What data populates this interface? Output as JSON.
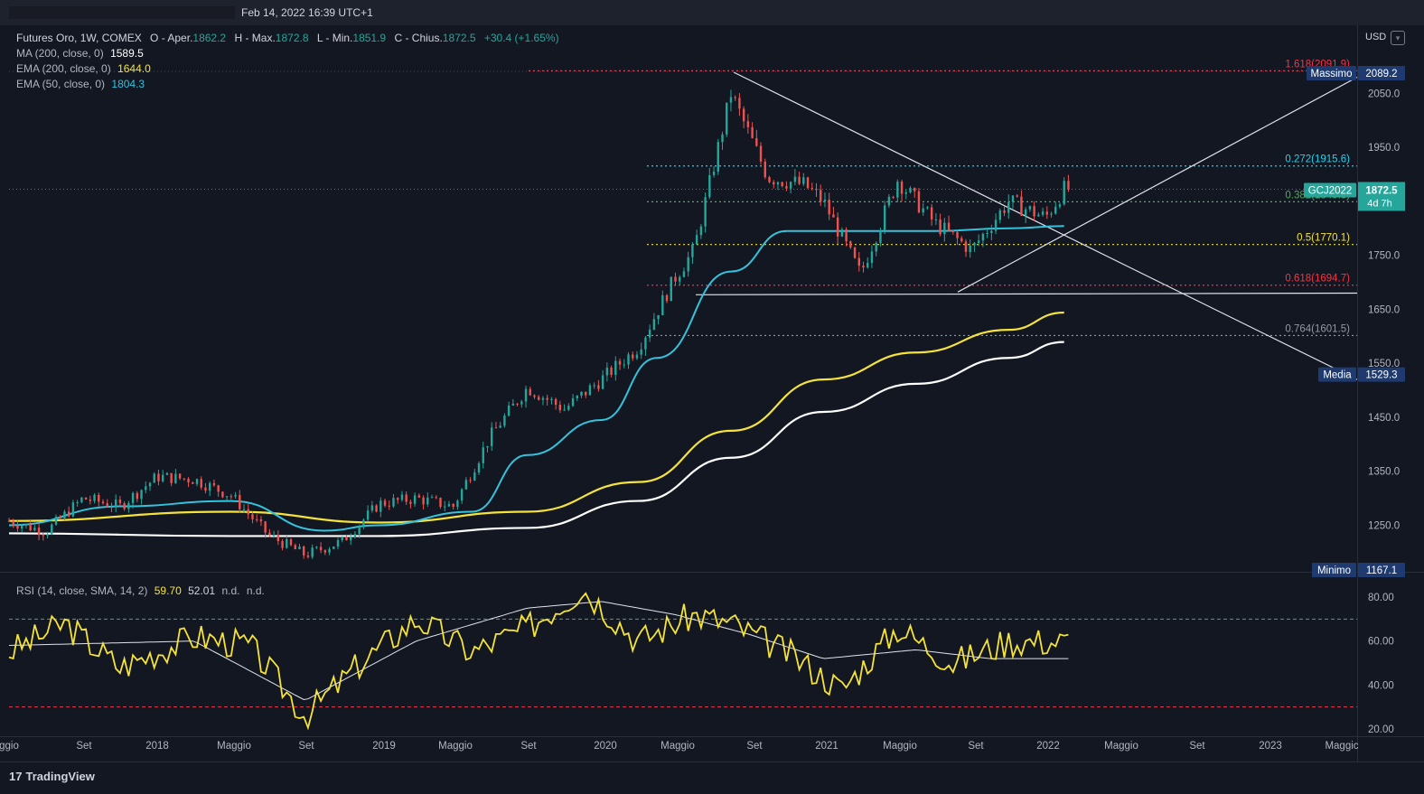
{
  "header": {
    "timestamp": "Feb 14, 2022 16:39 UTC+1"
  },
  "legend": {
    "main_title": "Futures Oro, 1W, COMEX",
    "open_label": "O - Aper.",
    "open": "1862.2",
    "high_label": "H - Max.",
    "high": "1872.8",
    "low_label": "L - Min.",
    "low": "1851.9",
    "close_label": "C - Chius.",
    "close": "1872.5",
    "change": "+30.4 (+1.65%)",
    "ma200": {
      "label": "MA (200, close, 0)",
      "value": "1589.5",
      "color": "#ffffff"
    },
    "ema200": {
      "label": "EMA (200, close, 0)",
      "value": "1644.0",
      "color": "#f5e33a"
    },
    "ema50": {
      "label": "EMA (50, close, 0)",
      "value": "1804.3",
      "color": "#33c3dd"
    }
  },
  "rsi_legend": {
    "label": "RSI (14, close, SMA, 14, 2)",
    "rsi": "59.70",
    "sma": "52.01",
    "na1": "n.d.",
    "na2": "n.d."
  },
  "currency": "USD",
  "price_axis": {
    "ticks": [
      "2050.0",
      "1950.0",
      "1750.0",
      "1650.0",
      "1550.0",
      "1450.0",
      "1350.0",
      "1250.0"
    ]
  },
  "rsi_axis": {
    "ticks": [
      "80.00",
      "60.00",
      "40.00",
      "20.00"
    ]
  },
  "time_axis": [
    "ggio",
    "Set",
    "2018",
    "Maggio",
    "Set",
    "2019",
    "Maggio",
    "Set",
    "2020",
    "Maggio",
    "Set",
    "2021",
    "Maggio",
    "Set",
    "2022",
    "Maggio",
    "Set",
    "2023",
    "Maggic"
  ],
  "fib_levels": [
    {
      "label": "1.618(2091.9)",
      "value": 2091.9,
      "color": "#f23645"
    },
    {
      "label": "0.272(1915.6)",
      "value": 1915.6,
      "color": "#22d3ee"
    },
    {
      "label": "0.382(1849.3)",
      "value": 1849.3,
      "color": "#4caf50"
    },
    {
      "label": "0.5(1770.1)",
      "value": 1770.1,
      "color": "#f5e33a"
    },
    {
      "label": "0.618(1694.7)",
      "value": 1694.7,
      "color": "#f23645"
    },
    {
      "label": "0.764(1601.5)",
      "value": 1601.5,
      "color": "#9598a1"
    }
  ],
  "badges": {
    "high_label": "Massimo",
    "high_value": "2089.2",
    "mid_label": "Media",
    "mid_value": "1529.3",
    "low_label": "Minimo",
    "low_value": "1167.1",
    "symbol": "GCJ2022",
    "last": "1872.5",
    "countdown": "4d 7h"
  },
  "brand": "TradingView",
  "chart_data": {
    "type": "candlestick",
    "title": "Futures Oro, 1W, COMEX",
    "y_range": [
      1150,
      2120
    ],
    "rsi_range": [
      18,
      86
    ],
    "rsi_levels": [
      70,
      30
    ],
    "series": [
      {
        "name": "Futures Oro",
        "x": [
          "2017-05",
          "2017-07",
          "2017-09",
          "2017-11",
          "2018-01",
          "2018-03",
          "2018-05",
          "2018-07",
          "2018-09",
          "2018-11",
          "2019-01",
          "2019-03",
          "2019-05",
          "2019-07",
          "2019-09",
          "2019-11",
          "2020-01",
          "2020-03",
          "2020-05",
          "2020-06",
          "2020-08",
          "2020-10",
          "2020-12",
          "2021-01",
          "2021-03",
          "2021-05",
          "2021-07",
          "2021-09",
          "2021-11",
          "2022-01",
          "2022-02"
        ],
        "values": [
          1258,
          1238,
          1300,
          1285,
          1340,
          1335,
          1305,
          1232,
          1195,
          1220,
          1290,
          1300,
          1285,
          1415,
          1505,
          1465,
          1520,
          1580,
          1710,
          1760,
          2050,
          1895,
          1880,
          1850,
          1715,
          1890,
          1810,
          1760,
          1850,
          1820,
          1872.5
        ]
      },
      {
        "name": "MA (200, close, 0)",
        "x": [
          "2017-05",
          "2018-05",
          "2019-01",
          "2019-09",
          "2020-03",
          "2020-08",
          "2021-01",
          "2021-06",
          "2021-11",
          "2022-02"
        ],
        "values": [
          1235,
          1230,
          1230,
          1245,
          1295,
          1375,
          1460,
          1512,
          1560,
          1589.5
        ]
      },
      {
        "name": "EMA (200, close, 0)",
        "x": [
          "2017-05",
          "2018-05",
          "2019-01",
          "2019-09",
          "2020-03",
          "2020-08",
          "2021-01",
          "2021-06",
          "2021-11",
          "2022-02"
        ],
        "values": [
          1258,
          1275,
          1255,
          1275,
          1330,
          1425,
          1520,
          1570,
          1612,
          1644
        ]
      },
      {
        "name": "EMA (50, close, 0)",
        "x": [
          "2017-05",
          "2017-11",
          "2018-05",
          "2018-10",
          "2019-01",
          "2019-06",
          "2019-09",
          "2020-01",
          "2020-04",
          "2020-08",
          "2020-11",
          "2021-03",
          "2021-07",
          "2021-11",
          "2022-02"
        ],
        "values": [
          1250,
          1285,
          1295,
          1240,
          1250,
          1275,
          1380,
          1445,
          1560,
          1720,
          1795,
          1795,
          1795,
          1800,
          1804.3
        ]
      },
      {
        "name": "RSI (14, close, SMA, 14, 2)",
        "x": [
          "2017-05",
          "2017-08",
          "2017-11",
          "2018-03",
          "2018-06",
          "2018-09",
          "2018-12",
          "2019-03",
          "2019-06",
          "2019-09",
          "2019-12",
          "2020-03",
          "2020-06",
          "2020-08",
          "2020-11",
          "2021-02",
          "2021-05",
          "2021-08",
          "2021-11",
          "2022-02"
        ],
        "values": [
          55,
          68,
          48,
          62,
          58,
          26,
          50,
          70,
          55,
          66,
          84,
          60,
          72,
          68,
          55,
          38,
          66,
          50,
          60,
          59.7
        ]
      },
      {
        "name": "RSI-based SMA",
        "x": [
          "2017-05",
          "2018-03",
          "2018-09",
          "2019-03",
          "2019-09",
          "2020-01",
          "2020-05",
          "2020-09",
          "2021-01",
          "2021-06",
          "2021-10",
          "2022-02"
        ],
        "values": [
          58,
          60,
          33,
          60,
          75,
          78,
          72,
          63,
          52,
          56,
          52,
          52.01
        ]
      }
    ]
  }
}
